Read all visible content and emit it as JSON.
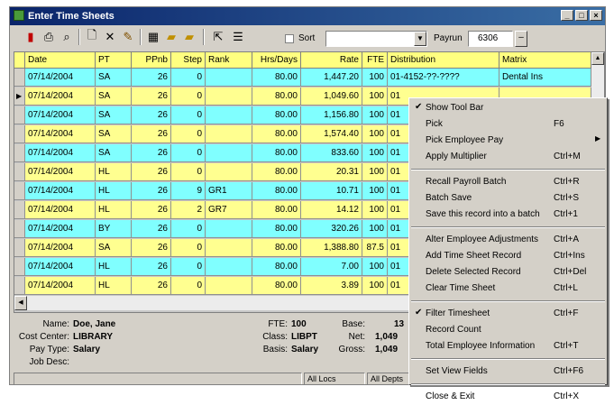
{
  "window": {
    "title": "Enter Time Sheets",
    "buttons": [
      "_",
      "□",
      "×"
    ]
  },
  "toolbar": {
    "icons": [
      "stop-icon",
      "print-icon",
      "preview-icon",
      "new-icon",
      "delete-icon",
      "edit-icon",
      "calculate-icon",
      "open-icon",
      "save-icon",
      "pointer-icon",
      "options-icon"
    ],
    "sort_label": "Sort",
    "sort_value": "",
    "payrun_label": "Payrun",
    "payrun_value": "6306"
  },
  "grid": {
    "columns": [
      "Date",
      "PT",
      "PPnb",
      "Step",
      "Rank",
      "Hrs/Days",
      "Rate",
      "FTE",
      "Distribution",
      "Matrix"
    ],
    "rows": [
      {
        "date": "07/14/2004",
        "pt": "SA",
        "ppnb": "26",
        "step": "0",
        "rank": "",
        "hrs": "80.00",
        "rate": "1,447.20",
        "fte": "100",
        "dist": "01-4152-??-????",
        "matrix": "Dental Ins",
        "color": "cyan",
        "current": false
      },
      {
        "date": "07/14/2004",
        "pt": "SA",
        "ppnb": "26",
        "step": "0",
        "rank": "",
        "hrs": "80.00",
        "rate": "1,049.60",
        "fte": "100",
        "dist": "01",
        "matrix": "",
        "color": "yellow",
        "current": true
      },
      {
        "date": "07/14/2004",
        "pt": "SA",
        "ppnb": "26",
        "step": "0",
        "rank": "",
        "hrs": "80.00",
        "rate": "1,156.80",
        "fte": "100",
        "dist": "01",
        "matrix": "",
        "color": "cyan",
        "current": false
      },
      {
        "date": "07/14/2004",
        "pt": "SA",
        "ppnb": "26",
        "step": "0",
        "rank": "",
        "hrs": "80.00",
        "rate": "1,574.40",
        "fte": "100",
        "dist": "01",
        "matrix": "",
        "color": "yellow",
        "current": false
      },
      {
        "date": "07/14/2004",
        "pt": "SA",
        "ppnb": "26",
        "step": "0",
        "rank": "",
        "hrs": "80.00",
        "rate": "833.60",
        "fte": "100",
        "dist": "01",
        "matrix": "",
        "color": "cyan",
        "current": false
      },
      {
        "date": "07/14/2004",
        "pt": "HL",
        "ppnb": "26",
        "step": "0",
        "rank": "",
        "hrs": "80.00",
        "rate": "20.31",
        "fte": "100",
        "dist": "01",
        "matrix": "",
        "color": "yellow",
        "current": false
      },
      {
        "date": "07/14/2004",
        "pt": "HL",
        "ppnb": "26",
        "step": "9",
        "rank": "GR1",
        "hrs": "80.00",
        "rate": "10.71",
        "fte": "100",
        "dist": "01",
        "matrix": "",
        "color": "cyan",
        "current": false
      },
      {
        "date": "07/14/2004",
        "pt": "HL",
        "ppnb": "26",
        "step": "2",
        "rank": "GR7",
        "hrs": "80.00",
        "rate": "14.12",
        "fte": "100",
        "dist": "01",
        "matrix": "",
        "color": "yellow",
        "current": false
      },
      {
        "date": "07/14/2004",
        "pt": "BY",
        "ppnb": "26",
        "step": "0",
        "rank": "",
        "hrs": "80.00",
        "rate": "320.26",
        "fte": "100",
        "dist": "01",
        "matrix": "",
        "color": "cyan",
        "current": false
      },
      {
        "date": "07/14/2004",
        "pt": "SA",
        "ppnb": "26",
        "step": "0",
        "rank": "",
        "hrs": "80.00",
        "rate": "1,388.80",
        "fte": "87.5",
        "dist": "01",
        "matrix": "",
        "color": "yellow",
        "current": false
      },
      {
        "date": "07/14/2004",
        "pt": "HL",
        "ppnb": "26",
        "step": "0",
        "rank": "",
        "hrs": "80.00",
        "rate": "7.00",
        "fte": "100",
        "dist": "01",
        "matrix": "",
        "color": "cyan",
        "current": false
      },
      {
        "date": "07/14/2004",
        "pt": "HL",
        "ppnb": "26",
        "step": "0",
        "rank": "",
        "hrs": "80.00",
        "rate": "3.89",
        "fte": "100",
        "dist": "01",
        "matrix": "",
        "color": "yellow",
        "current": false
      }
    ]
  },
  "info": {
    "name_label": "Name:",
    "name": "Doe, Jane",
    "cost_center_label": "Cost Center:",
    "cost_center": "LIBRARY",
    "pay_type_label": "Pay Type:",
    "pay_type": "Salary",
    "job_desc_label": "Job Desc:",
    "fte_label": "FTE:",
    "fte": "100",
    "class_label": "Class:",
    "class": "LIBPT",
    "basis_label": "Basis:",
    "basis": "Salary",
    "base_label": "Base:",
    "base": "13",
    "net_label": "Net:",
    "net": "1,049",
    "gross_label": "Gross:",
    "gross": "1,049"
  },
  "status": {
    "loc": "All Locs",
    "depts": "All Depts"
  },
  "context_menu": [
    {
      "label": "Show Tool Bar",
      "shortcut": "",
      "checked": true
    },
    {
      "label": "Pick",
      "shortcut": "F6"
    },
    {
      "label": "Pick Employee Pay",
      "shortcut": "",
      "submenu": true
    },
    {
      "label": "Apply Multiplier",
      "shortcut": "Ctrl+M"
    },
    {
      "sep": true
    },
    {
      "label": "Recall Payroll Batch",
      "shortcut": "Ctrl+R"
    },
    {
      "label": "Batch Save",
      "shortcut": "Ctrl+S"
    },
    {
      "label": "Save this record into a batch",
      "shortcut": "Ctrl+1"
    },
    {
      "sep": true
    },
    {
      "label": "Alter Employee Adjustments",
      "shortcut": "Ctrl+A"
    },
    {
      "label": "Add Time Sheet Record",
      "shortcut": "Ctrl+Ins"
    },
    {
      "label": "Delete Selected Record",
      "shortcut": "Ctrl+Del"
    },
    {
      "label": "Clear Time Sheet",
      "shortcut": "Ctrl+L"
    },
    {
      "sep": true
    },
    {
      "label": "Filter Timesheet",
      "shortcut": "Ctrl+F",
      "checked": true
    },
    {
      "label": "Record Count",
      "shortcut": ""
    },
    {
      "label": "Total Employee Information",
      "shortcut": "Ctrl+T"
    },
    {
      "sep": true
    },
    {
      "label": "Set View Fields",
      "shortcut": "Ctrl+F6"
    },
    {
      "sep": true
    },
    {
      "label": "Close & Exit",
      "shortcut": "Ctrl+X"
    }
  ],
  "colors": {
    "title_bar": "#0a246a",
    "header": "#ffff80",
    "row_cyan": "#80ffff",
    "row_yellow": "#ffff90"
  }
}
